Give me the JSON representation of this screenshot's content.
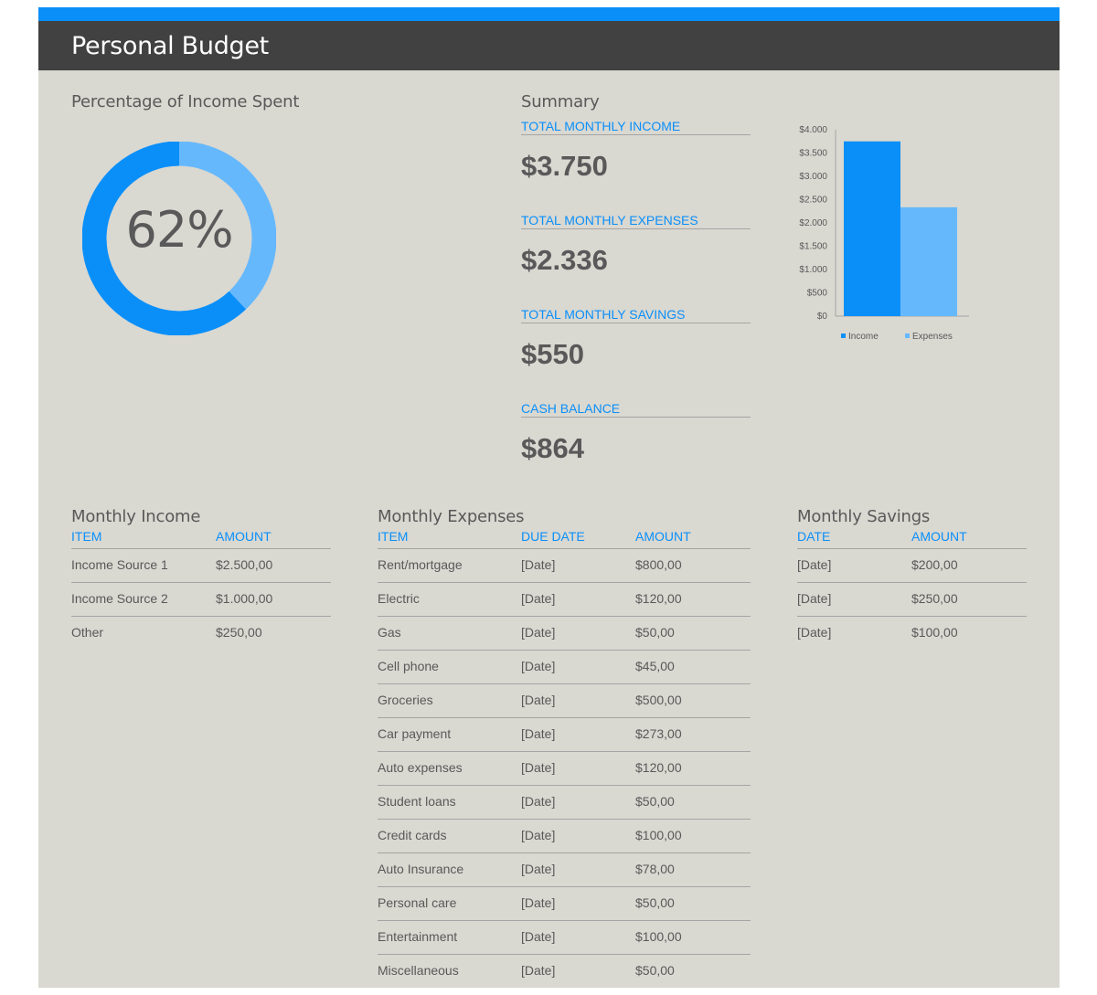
{
  "app": {
    "title": "Personal Budget"
  },
  "percent_section": {
    "title": "Percentage of Income Spent",
    "percent_label": "62%",
    "percent_value": 0.62
  },
  "summary": {
    "title": "Summary",
    "items": [
      {
        "label": "TOTAL MONTHLY INCOME",
        "value": "$3.750"
      },
      {
        "label": "TOTAL MONTHLY EXPENSES",
        "value": "$2.336"
      },
      {
        "label": "TOTAL MONTHLY SAVINGS",
        "value": "$550"
      },
      {
        "label": "CASH BALANCE",
        "value": "$864"
      }
    ]
  },
  "chart_data": {
    "type": "bar",
    "categories": [
      ""
    ],
    "series": [
      {
        "name": "Income",
        "values": [
          3750
        ],
        "color": "#0a8ff9"
      },
      {
        "name": "Expenses",
        "values": [
          2336
        ],
        "color": "#66b8fc"
      }
    ],
    "yticks": [
      "$4.000",
      "$3.500",
      "$3.000",
      "$2.500",
      "$2.000",
      "$1.500",
      "$1.000",
      "$500",
      "$0"
    ],
    "ylim": [
      0,
      4000
    ],
    "legend": "bottom"
  },
  "income": {
    "title": "Monthly Income",
    "headers": [
      "ITEM",
      "AMOUNT"
    ],
    "rows": [
      [
        "Income Source 1",
        "$2.500,00"
      ],
      [
        "Income Source 2",
        "$1.000,00"
      ],
      [
        "Other",
        "$250,00"
      ]
    ]
  },
  "expenses": {
    "title": "Monthly Expenses",
    "headers": [
      "ITEM",
      "DUE DATE",
      "AMOUNT"
    ],
    "rows": [
      [
        "Rent/mortgage",
        "[Date]",
        "$800,00"
      ],
      [
        "Electric",
        "[Date]",
        "$120,00"
      ],
      [
        "Gas",
        "[Date]",
        "$50,00"
      ],
      [
        "Cell phone",
        "[Date]",
        "$45,00"
      ],
      [
        "Groceries",
        "[Date]",
        "$500,00"
      ],
      [
        "Car payment",
        "[Date]",
        "$273,00"
      ],
      [
        "Auto expenses",
        "[Date]",
        "$120,00"
      ],
      [
        "Student loans",
        "[Date]",
        "$50,00"
      ],
      [
        "Credit cards",
        "[Date]",
        "$100,00"
      ],
      [
        "Auto Insurance",
        "[Date]",
        "$78,00"
      ],
      [
        "Personal care",
        "[Date]",
        "$50,00"
      ],
      [
        "Entertainment",
        "[Date]",
        "$100,00"
      ],
      [
        "Miscellaneous",
        "[Date]",
        "$50,00"
      ]
    ]
  },
  "savings": {
    "title": "Monthly Savings",
    "headers": [
      "DATE",
      "AMOUNT"
    ],
    "rows": [
      [
        "[Date]",
        "$200,00"
      ],
      [
        "[Date]",
        "$250,00"
      ],
      [
        "[Date]",
        "$100,00"
      ]
    ]
  },
  "colors": {
    "accent": "#0a8ff9",
    "accent_light": "#66b8fc",
    "header": "#414141",
    "sheet": "#d9d8d1",
    "text": "#595959"
  }
}
